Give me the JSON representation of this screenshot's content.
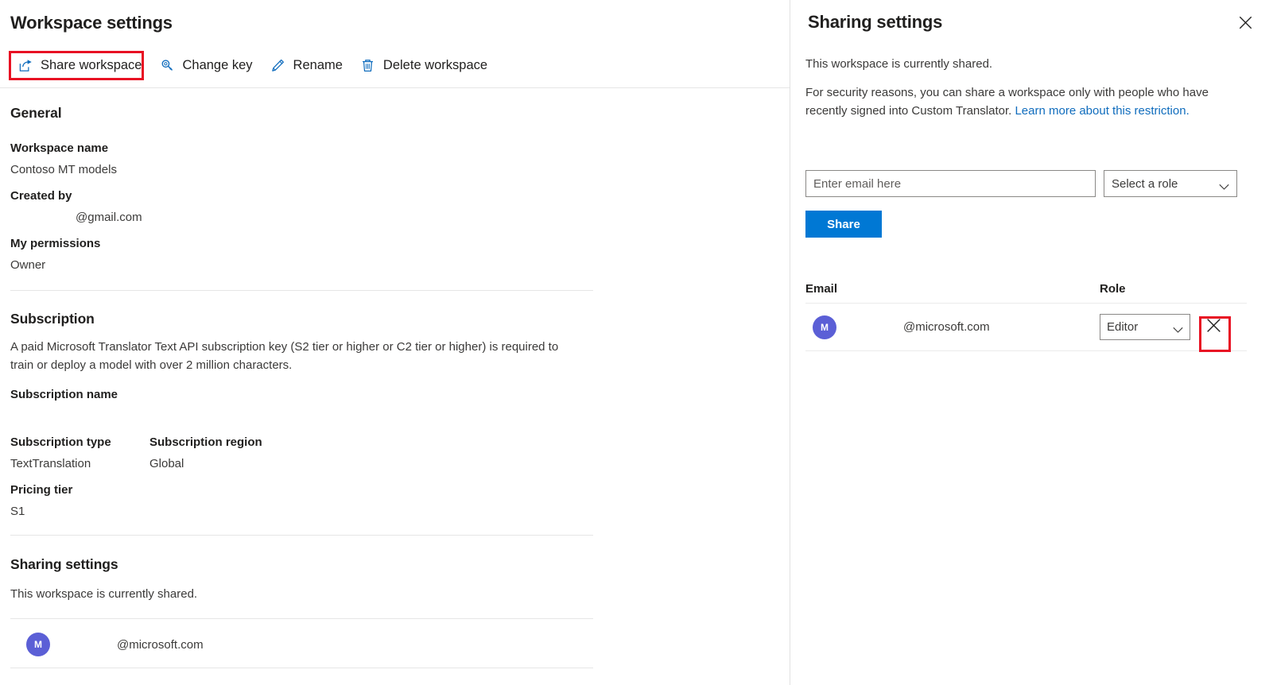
{
  "left_panel": {
    "title": "Workspace settings",
    "toolbar": [
      {
        "label": "Share workspace",
        "icon": "share-icon"
      },
      {
        "label": "Change key",
        "icon": "key-icon"
      },
      {
        "label": "Rename",
        "icon": "pencil-icon"
      },
      {
        "label": "Delete workspace",
        "icon": "trash-icon"
      }
    ],
    "general": {
      "heading": "General",
      "workspace_name_label": "Workspace name",
      "workspace_name_value": "Contoso MT models",
      "created_by_label": "Created by",
      "created_by_value": "@gmail.com",
      "permissions_label": "My permissions",
      "permissions_value": "Owner"
    },
    "subscription": {
      "heading": "Subscription",
      "description": "A paid Microsoft Translator Text API subscription key (S2 tier or higher or C2 tier or higher) is required to train or deploy a model with over 2 million characters.",
      "name_label": "Subscription name",
      "name_value": "",
      "type_label": "Subscription type",
      "type_value": "TextTranslation",
      "region_label": "Subscription region",
      "region_value": "Global",
      "pricing_label": "Pricing tier",
      "pricing_value": "S1"
    },
    "sharing": {
      "heading": "Sharing settings",
      "status": "This workspace is currently shared.",
      "members": [
        {
          "initial": "M",
          "email": "@microsoft.com"
        }
      ]
    }
  },
  "right_panel": {
    "title": "Sharing settings",
    "close_icon": "close-icon",
    "status": "This workspace is currently shared.",
    "note_prefix": "For security reasons, you can share a workspace only with people who have recently signed into Custom Translator. ",
    "note_link": "Learn more about this restriction.",
    "email_input_placeholder": "Enter email here",
    "email_input_value": "",
    "role_select_value": "Select a role",
    "share_button_label": "Share",
    "table": {
      "columns": [
        "Email",
        "Role"
      ],
      "rows": [
        {
          "initial": "M",
          "email": "@microsoft.com",
          "role": "Editor",
          "remove_icon": "close-icon"
        }
      ]
    }
  },
  "colors": {
    "accent": "#0078d4",
    "link": "#0f6cbd",
    "highlight": "#e81123",
    "avatar": "#5b5fd6"
  }
}
